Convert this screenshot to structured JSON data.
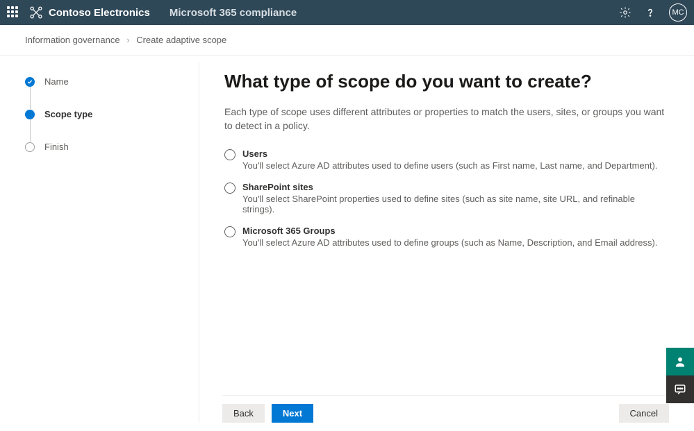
{
  "header": {
    "company": "Contoso Electronics",
    "suite": "Microsoft 365 compliance",
    "avatar": "MC"
  },
  "breadcrumb": {
    "parent": "Information governance",
    "current": "Create adaptive scope"
  },
  "steps": {
    "s0": {
      "label": "Name"
    },
    "s1": {
      "label": "Scope type"
    },
    "s2": {
      "label": "Finish"
    }
  },
  "main": {
    "heading": "What type of scope do you want to create?",
    "description": "Each type of scope uses different attributes or properties to match the users, sites, or groups you want to detect in a policy.",
    "options": {
      "users": {
        "title": "Users",
        "desc": "You'll select Azure AD attributes used to define users (such as First name, Last name, and Department)."
      },
      "sites": {
        "title": "SharePoint sites",
        "desc": "You'll select SharePoint properties used to define sites (such as site name, site URL, and refinable strings)."
      },
      "groups": {
        "title": "Microsoft 365 Groups",
        "desc": "You'll select Azure AD attributes used to define groups (such as Name, Description, and Email address)."
      }
    }
  },
  "footer": {
    "back": "Back",
    "next": "Next",
    "cancel": "Cancel"
  }
}
